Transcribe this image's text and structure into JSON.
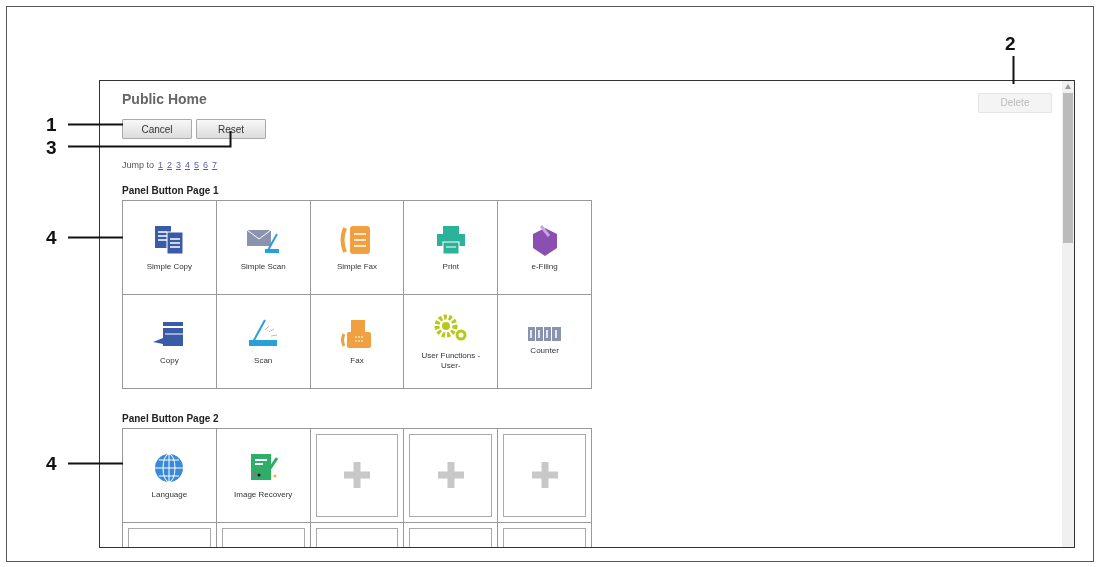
{
  "callouts": [
    "1",
    "2",
    "3",
    "4",
    "4"
  ],
  "screen": {
    "title": "Public Home",
    "buttons": [
      {
        "label": "Cancel",
        "disabled": false
      },
      {
        "label": "Reset",
        "disabled": false
      }
    ],
    "delete_button": {
      "label": "Delete",
      "disabled": true
    },
    "jump": {
      "label": "Jump to",
      "links": [
        "1",
        "2",
        "3",
        "4",
        "5",
        "6",
        "7"
      ]
    },
    "pages": [
      {
        "heading": "Panel Button Page 1",
        "tiles": [
          {
            "kind": "app",
            "label": "Simple Copy"
          },
          {
            "kind": "app",
            "label": "Simple Scan"
          },
          {
            "kind": "app",
            "label": "Simple Fax"
          },
          {
            "kind": "app",
            "label": "Print"
          },
          {
            "kind": "app",
            "label": "e-Filing"
          },
          {
            "kind": "app",
            "label": "Copy"
          },
          {
            "kind": "app",
            "label": "Scan"
          },
          {
            "kind": "app",
            "label": "Fax"
          },
          {
            "kind": "app",
            "label": "User Functions -User-"
          },
          {
            "kind": "app",
            "label": "Counter"
          }
        ]
      },
      {
        "heading": "Panel Button Page 2",
        "tiles": [
          {
            "kind": "app",
            "label": "Language"
          },
          {
            "kind": "app",
            "label": "Image Recovery"
          },
          {
            "kind": "add"
          },
          {
            "kind": "add"
          },
          {
            "kind": "add"
          },
          {
            "kind": "empty"
          },
          {
            "kind": "empty"
          },
          {
            "kind": "empty"
          },
          {
            "kind": "empty"
          },
          {
            "kind": "empty"
          }
        ]
      }
    ]
  }
}
